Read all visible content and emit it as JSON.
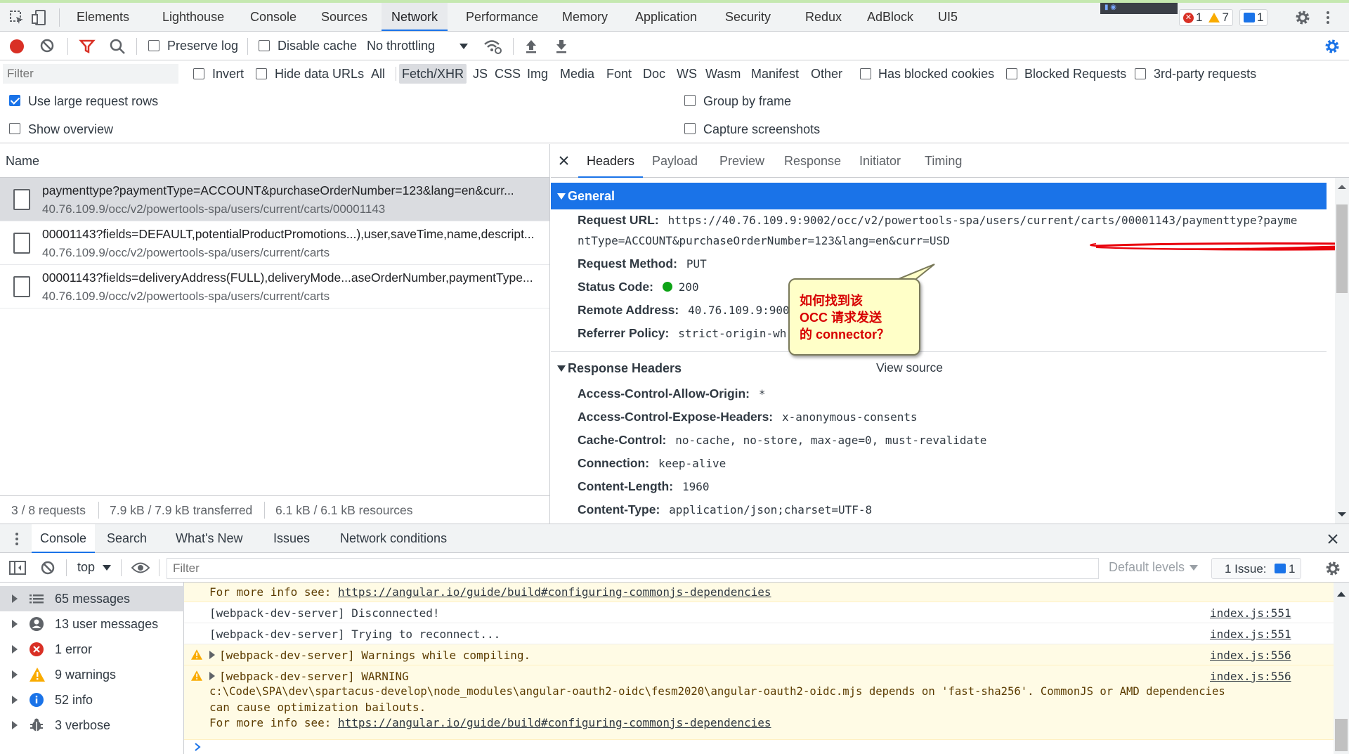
{
  "colors": {
    "accent": "#1a73e8",
    "record_red": "#d93025",
    "callout_bg": "#ffffc8",
    "callout_text": "#d70000",
    "underline": "#e8000b",
    "status_green": "#0ea316"
  },
  "tabs": [
    "Elements",
    "Lighthouse",
    "Console",
    "Sources",
    "Network",
    "Performance",
    "Memory",
    "Application",
    "Security",
    "Redux",
    "AdBlock",
    "UI5"
  ],
  "counters": {
    "errors": "1",
    "warnings": "7",
    "messages": "1"
  },
  "toolbar": {
    "preserve_log": "Preserve log",
    "disable_cache": "Disable cache",
    "throttling": "No throttling"
  },
  "filter": {
    "placeholder": "Filter",
    "invert": "Invert",
    "hide_data_urls": "Hide data URLs",
    "types": [
      "All",
      "Fetch/XHR",
      "JS",
      "CSS",
      "Img",
      "Media",
      "Font",
      "Doc",
      "WS",
      "Wasm",
      "Manifest",
      "Other"
    ],
    "has_blocked_cookies": "Has blocked cookies",
    "blocked_requests": "Blocked Requests",
    "third_party": "3rd-party requests"
  },
  "settings": {
    "large_rows": "Use large request rows",
    "show_overview": "Show overview",
    "group_by_frame": "Group by frame",
    "capture_screenshots": "Capture screenshots"
  },
  "requests": {
    "header": "Name",
    "rows": [
      {
        "name": "paymenttype?paymentType=ACCOUNT&purchaseOrderNumber=123&lang=en&curr...",
        "path": "40.76.109.9/occ/v2/powertools-spa/users/current/carts/00001143"
      },
      {
        "name": "00001143?fields=DEFAULT,potentialProductPromotions...),user,saveTime,name,descript...",
        "path": "40.76.109.9/occ/v2/powertools-spa/users/current/carts"
      },
      {
        "name": "00001143?fields=deliveryAddress(FULL),deliveryMode...aseOrderNumber,paymentType...",
        "path": "40.76.109.9/occ/v2/powertools-spa/users/current/carts"
      }
    ],
    "status": {
      "count": "3 / 8 requests",
      "transferred": "7.9 kB / 7.9 kB transferred",
      "resources": "6.1 kB / 6.1 kB resources"
    }
  },
  "detail": {
    "tabs": [
      "Headers",
      "Payload",
      "Preview",
      "Response",
      "Initiator",
      "Timing"
    ],
    "general_title": "General",
    "request_url_key": "Request URL:",
    "request_url_line1": "https://40.76.109.9:9002/occ/v2/powertools-spa/users/current/carts/00001143/paymenttype?payme",
    "request_url_line2": "ntType=ACCOUNT&purchaseOrderNumber=123&lang=en&curr=USD",
    "method_key": "Request Method:",
    "method_val": "PUT",
    "status_key": "Status Code:",
    "status_val": "200",
    "remote_key": "Remote Address:",
    "remote_val": "40.76.109.9:900",
    "referrer_key": "Referrer Policy:",
    "referrer_val": "strict-origin-wh",
    "response_title": "Response Headers",
    "view_source": "View source",
    "response_headers": [
      {
        "key": "Access-Control-Allow-Origin:",
        "val": "*"
      },
      {
        "key": "Access-Control-Expose-Headers:",
        "val": "x-anonymous-consents"
      },
      {
        "key": "Cache-Control:",
        "val": "no-cache, no-store, max-age=0, must-revalidate"
      },
      {
        "key": "Connection:",
        "val": "keep-alive"
      },
      {
        "key": "Content-Length:",
        "val": "1960"
      },
      {
        "key": "Content-Type:",
        "val": "application/json;charset=UTF-8"
      }
    ]
  },
  "callout": {
    "line1": "如何找到该",
    "line2": "OCC 请求发送",
    "line3": "的 connector？"
  },
  "drawer": {
    "tabs": [
      "Console",
      "Search",
      "What's New",
      "Issues",
      "Network conditions"
    ],
    "context": "top",
    "filter_placeholder": "Filter",
    "default_levels": "Default levels",
    "issues_label": "1 Issue:",
    "issues_count": "1"
  },
  "console_sidebar": [
    {
      "label": "65 messages",
      "icon": "list-icon"
    },
    {
      "label": "13 user messages",
      "icon": "user-icon"
    },
    {
      "label": "1 error",
      "icon": "error-icon"
    },
    {
      "label": "9 warnings",
      "icon": "warning-icon"
    },
    {
      "label": "52 info",
      "icon": "info-icon"
    },
    {
      "label": "3 verbose",
      "icon": "verbose-icon"
    }
  ],
  "console_log": {
    "line0_prefix": "For more info see: ",
    "line0_link": "https://angular.io/guide/build#configuring-commonjs-dependencies",
    "line1": "[webpack-dev-server] Disconnected!",
    "line1_src": "index.js:551",
    "line2": "[webpack-dev-server] Trying to reconnect...",
    "line2_src": "index.js:551",
    "line3": "[webpack-dev-server] Warnings while compiling.",
    "line3_src": "index.js:556",
    "line4": "[webpack-dev-server] WARNING",
    "line4_src": "index.js:556",
    "line4b": "c:\\Code\\SPA\\dev\\spartacus-develop\\node_modules\\angular-oauth2-oidc\\fesm2020\\angular-oauth2-oidc.mjs depends on 'fast-sha256'. CommonJS or AMD dependencies",
    "line4c": "can cause optimization bailouts.",
    "line4d_prefix": "For more info see: ",
    "line4d_link": "https://angular.io/guide/build#configuring-commonjs-dependencies"
  }
}
